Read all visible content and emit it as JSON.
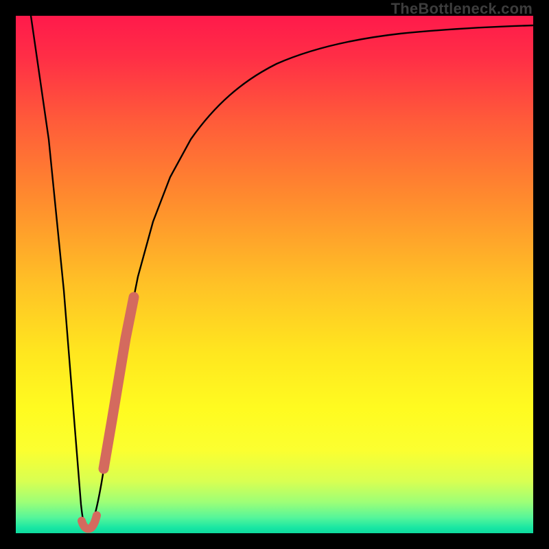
{
  "watermark": "TheBottleneck.com",
  "colors": {
    "frame": "#000000",
    "curve": "#000000",
    "highlight": "#d46a5e"
  },
  "chart_data": {
    "type": "line",
    "title": "",
    "xlabel": "",
    "ylabel": "",
    "xlim": [
      0,
      100
    ],
    "ylim": [
      0,
      100
    ],
    "grid": false,
    "legend": false,
    "series": [
      {
        "name": "curve",
        "x": [
          3,
          6,
          9,
          11,
          12.5,
          14,
          16,
          18,
          20,
          22,
          24,
          26,
          28,
          31,
          35,
          40,
          46,
          52,
          60,
          68,
          76,
          84,
          92,
          100
        ],
        "y": [
          100,
          60,
          25,
          6,
          1,
          3,
          12,
          25,
          38,
          49,
          57,
          63,
          68,
          73,
          78,
          82,
          85.5,
          88,
          90.2,
          91.8,
          93,
          94,
          94.8,
          95.4
        ]
      }
    ],
    "highlight_segment": {
      "name": "gpu-range",
      "x_start": 13.5,
      "x_end": 23,
      "note": "thick salmon overlay on rising edge near minimum"
    },
    "annotations": [
      {
        "text": "TheBottleneck.com",
        "position": "top-right"
      }
    ]
  }
}
